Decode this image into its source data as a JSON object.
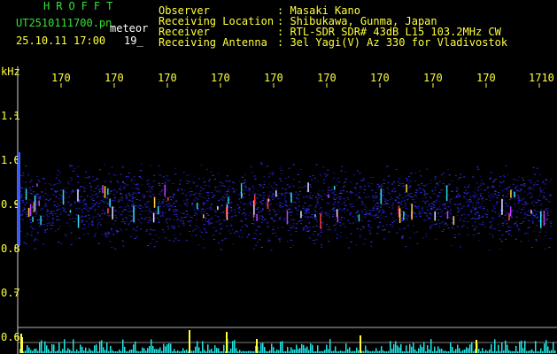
{
  "header": {
    "brand": "HROFFT",
    "filename": "UT2510111700.pn",
    "tag": "meteor",
    "datetime": "25.10.11 17:00",
    "frame": "19_"
  },
  "info": [
    {
      "label": "Observer",
      "value": ": Masaki Kano"
    },
    {
      "label": "Receiving Location",
      "value": ": Shibukawa, Gunma, Japan"
    },
    {
      "label": "Receiver",
      "value": ": RTL-SDR SDR# 43dB L15 103.2MHz CW"
    },
    {
      "label": "Receiving Antenna",
      "value": ": 3el Yagi(V) Az 330 for Vladivostok"
    }
  ],
  "axes": {
    "y_unit": "kHz",
    "x_ticks": [
      "170",
      "170",
      "170",
      "170",
      "170",
      "170",
      "170",
      "170",
      "170",
      "1710"
    ],
    "y_ticks": [
      "1.1",
      "1.0",
      "0.9",
      "0.8",
      "0.7",
      "0.6"
    ]
  },
  "colors": {
    "text_green": "#36e036",
    "text_yellow": "#ffff3c",
    "text_white": "#ffffff",
    "spectrum_cyan": "#1ee6e6",
    "noise_blue": "#2a2ad8"
  }
}
